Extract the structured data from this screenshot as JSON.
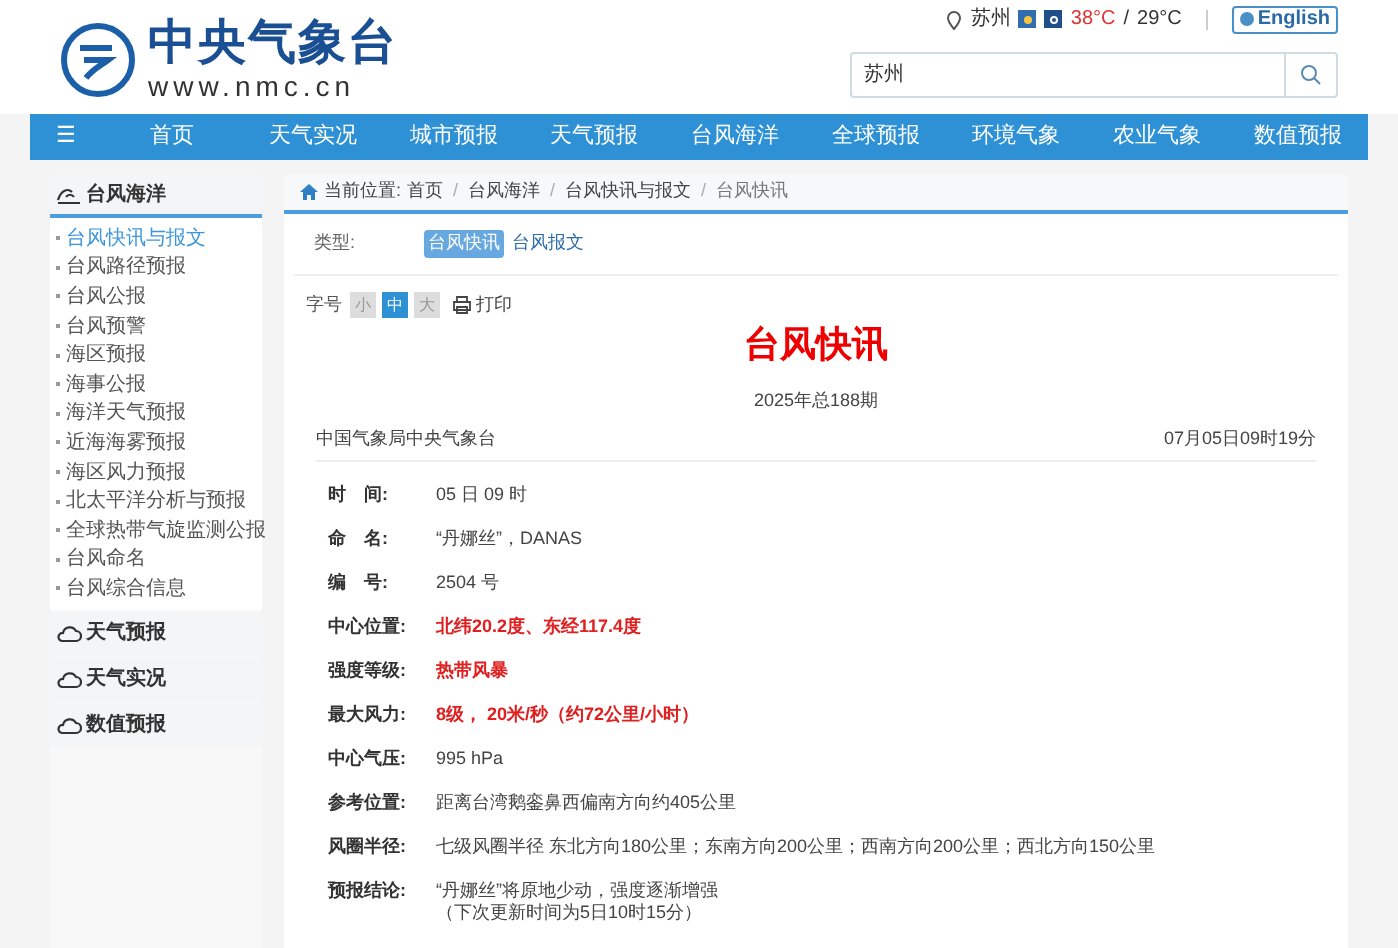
{
  "header": {
    "logo_title": "中央气象台",
    "logo_url": "www.nmc.cn",
    "city": "苏州",
    "temp_high": "38°C",
    "temp_sep": "/",
    "temp_low": "29°C",
    "language": "English",
    "search": {
      "value": "苏州"
    }
  },
  "nav": {
    "menu_glyph": "☰",
    "items": [
      {
        "label": "首页",
        "selected": false
      },
      {
        "label": "天气实况",
        "selected": false
      },
      {
        "label": "城市预报",
        "selected": false
      },
      {
        "label": "天气预报",
        "selected": false
      },
      {
        "label": "台风海洋",
        "selected": false
      },
      {
        "label": "全球预报",
        "selected": false
      },
      {
        "label": "环境气象",
        "selected": false
      },
      {
        "label": "农业气象",
        "selected": false
      },
      {
        "label": "数值预报",
        "selected": false
      }
    ]
  },
  "sidebar": {
    "sections": [
      {
        "title": "台风海洋",
        "expanded": true,
        "items": [
          {
            "label": "台风快讯与报文",
            "selected": true
          },
          {
            "label": "台风路径预报",
            "selected": false
          },
          {
            "label": "台风公报",
            "selected": false
          },
          {
            "label": "台风预警",
            "selected": false
          },
          {
            "label": "海区预报",
            "selected": false
          },
          {
            "label": "海事公报",
            "selected": false
          },
          {
            "label": "海洋天气预报",
            "selected": false
          },
          {
            "label": "近海海雾预报",
            "selected": false
          },
          {
            "label": "海区风力预报",
            "selected": false
          },
          {
            "label": "北太平洋分析与预报",
            "selected": false
          },
          {
            "label": "全球热带气旋监测公报",
            "selected": false
          },
          {
            "label": "台风命名",
            "selected": false
          },
          {
            "label": "台风综合信息",
            "selected": false
          }
        ]
      },
      {
        "title": "天气预报",
        "expanded": false
      },
      {
        "title": "天气实况",
        "expanded": false
      },
      {
        "title": "数值预报",
        "expanded": false
      }
    ]
  },
  "breadcrumb": {
    "label": "当前位置:",
    "items": [
      "首页",
      "台风海洋",
      "台风快讯与报文",
      "台风快讯"
    ],
    "separator": "/"
  },
  "type_filter": {
    "label": "类型:",
    "options": [
      {
        "label": "台风快讯",
        "selected": true
      },
      {
        "label": "台风报文",
        "selected": false
      }
    ]
  },
  "font_size": {
    "label": "字号",
    "options": [
      {
        "label": "小",
        "selected": false
      },
      {
        "label": "中",
        "selected": true
      },
      {
        "label": "大",
        "selected": false
      }
    ],
    "print": "打印"
  },
  "article": {
    "title": "台风快讯",
    "issue": "2025年总188期",
    "agency": "中国气象局中央气象台",
    "time": "07月05日09时19分",
    "fields": [
      {
        "label": "时　间:",
        "value": "05 日 09 时",
        "emphasis": false
      },
      {
        "label": "命　名:",
        "value": "“丹娜丝”，DANAS",
        "emphasis": false
      },
      {
        "label": "编　号:",
        "value": "2504 号",
        "emphasis": false
      },
      {
        "label": "中心位置:",
        "value": "北纬20.2度、东经117.4度",
        "emphasis": true
      },
      {
        "label": "强度等级:",
        "value": "热带风暴",
        "emphasis": true
      },
      {
        "label": "最大风力:",
        "value": "8级， 20米/秒（约72公里/小时）",
        "emphasis": true
      },
      {
        "label": "中心气压:",
        "value": "995 hPa",
        "emphasis": false
      },
      {
        "label": "参考位置:",
        "value": "距离台湾鹅銮鼻西偏南方向约405公里",
        "emphasis": false
      },
      {
        "label": "风圈半径:",
        "value": "七级风圈半径 东北方向180公里；东南方向200公里；西南方向200公里；西北方向150公里",
        "emphasis": false
      },
      {
        "label": "预报结论:",
        "value": "“丹娜丝”将原地少动，强度逐渐增强",
        "note": "（下次更新时间为5日10时15分）",
        "emphasis": false
      }
    ]
  }
}
